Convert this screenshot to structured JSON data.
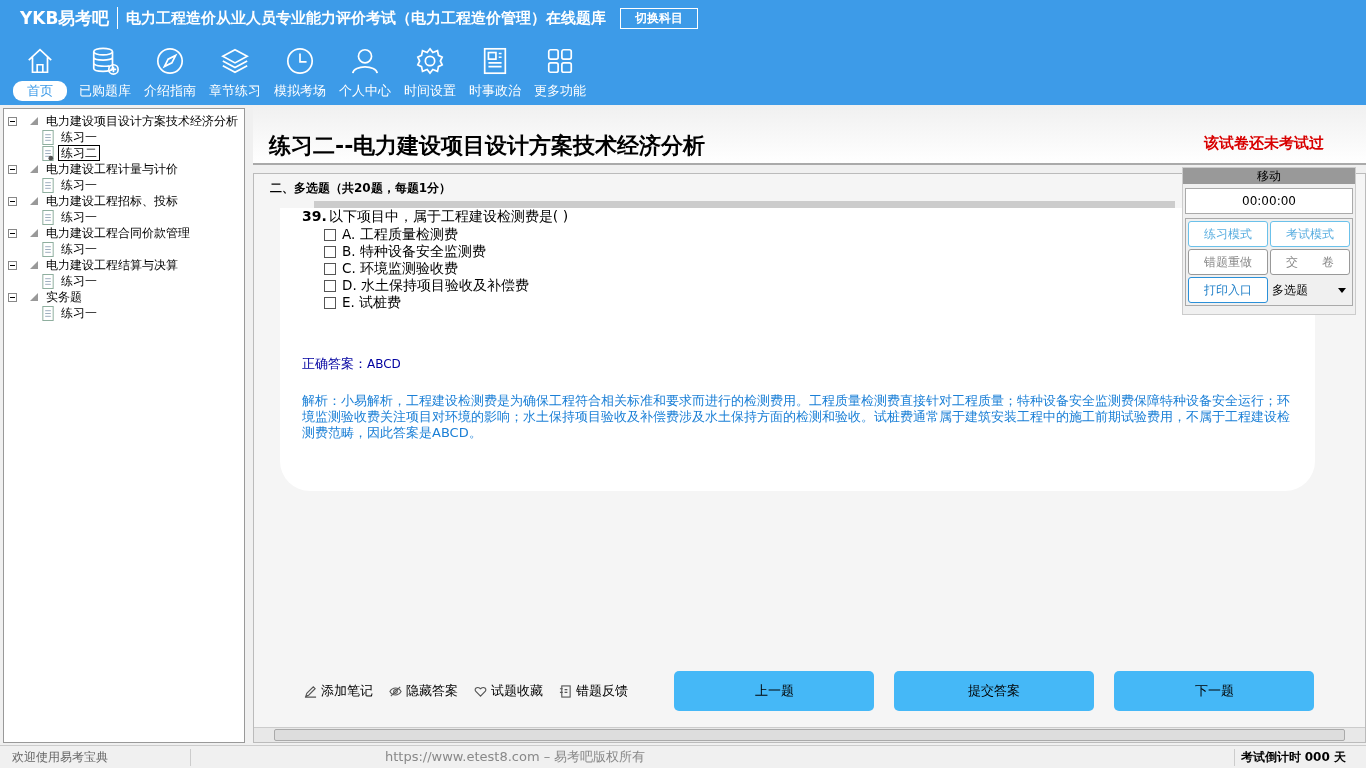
{
  "header": {
    "logo": "YKB易考吧",
    "title": "电力工程造价从业人员专业能力评价考试（电力工程造价管理）在线题库",
    "switch_button": "切换科目"
  },
  "nav": [
    {
      "label": "首页",
      "kind": "home",
      "selected": true
    },
    {
      "label": "已购题库",
      "kind": "database",
      "selected": false
    },
    {
      "label": "介绍指南",
      "kind": "compass",
      "selected": false
    },
    {
      "label": "章节练习",
      "kind": "layers",
      "selected": false
    },
    {
      "label": "模拟考场",
      "kind": "clock",
      "selected": false
    },
    {
      "label": "个人中心",
      "kind": "user",
      "selected": false
    },
    {
      "label": "时间设置",
      "kind": "gear",
      "selected": false
    },
    {
      "label": "时事政治",
      "kind": "news",
      "selected": false
    },
    {
      "label": "更多功能",
      "kind": "grid",
      "selected": false
    }
  ],
  "tree": [
    {
      "label": "电力建设项目设计方案技术经济分析",
      "expanded": true,
      "children": [
        {
          "label": "练习一",
          "selected": false
        },
        {
          "label": "练习二",
          "selected": true
        }
      ]
    },
    {
      "label": "电力建设工程计量与计价",
      "expanded": true,
      "children": [
        {
          "label": "练习一",
          "selected": false
        }
      ]
    },
    {
      "label": "电力建设工程招标、投标",
      "expanded": true,
      "children": [
        {
          "label": "练习一",
          "selected": false
        }
      ]
    },
    {
      "label": "电力建设工程合同价款管理",
      "expanded": true,
      "children": [
        {
          "label": "练习一",
          "selected": false
        }
      ]
    },
    {
      "label": "电力建设工程结算与决算",
      "expanded": true,
      "children": [
        {
          "label": "练习一",
          "selected": false
        }
      ]
    },
    {
      "label": "实务题",
      "expanded": true,
      "children": [
        {
          "label": "练习一",
          "selected": false
        }
      ]
    }
  ],
  "paper": {
    "title": "练习二--电力建设项目设计方案技术经济分析",
    "status": "该试卷还未考试过",
    "section": "二、多选题（共20题，每题1分）"
  },
  "question": {
    "number": "39.",
    "text": "以下项目中，属于工程建设检测费是( )",
    "options": [
      {
        "text": "A. 工程质量检测费",
        "checked": false
      },
      {
        "text": "B. 特种设备安全监测费",
        "checked": false
      },
      {
        "text": "C. 环境监测验收费",
        "checked": false
      },
      {
        "text": "D. 水土保持项目验收及补偿费",
        "checked": false
      },
      {
        "text": "E. 试桩费",
        "checked": false
      }
    ],
    "answer_label": "正确答案：",
    "answer": "ABCD",
    "explanation": "解析：小易解析，工程建设检测费是为确保工程符合相关标准和要求而进行的检测费用。工程质量检测费直接针对工程质量；特种设备安全监测费保障特种设备安全运行；环境监测验收费关注项目对环境的影响；水土保持项目验收及补偿费涉及水土保持方面的检测和验收。试桩费通常属于建筑安装工程中的施工前期试验费用，不属于工程建设检测费范畴，因此答案是ABCD。"
  },
  "tools": [
    {
      "label": "添加笔记",
      "kind": "pencil"
    },
    {
      "label": "隐藏答案",
      "kind": "eye"
    },
    {
      "label": "试题收藏",
      "kind": "heart"
    },
    {
      "label": "错题反馈",
      "kind": "note"
    }
  ],
  "buttons": [
    "上一题",
    "提交答案",
    "下一题"
  ],
  "panel": {
    "title": "移动",
    "timer": "00:00:00",
    "buttons": [
      {
        "label": "练习模式",
        "kind": "blue"
      },
      {
        "label": "考试模式",
        "kind": "blue"
      },
      {
        "label": "错题重做",
        "kind": "grey"
      },
      {
        "label": "交　　卷",
        "kind": "grey"
      },
      {
        "label": "打印入口",
        "kind": "blue"
      }
    ],
    "type_select": "多选题"
  },
  "status_bar": {
    "welcome": "欢迎使用易考宝典",
    "copyright": "https://www.etest8.com – 易考吧版权所有",
    "countdown": "考试倒计时 000 天"
  }
}
